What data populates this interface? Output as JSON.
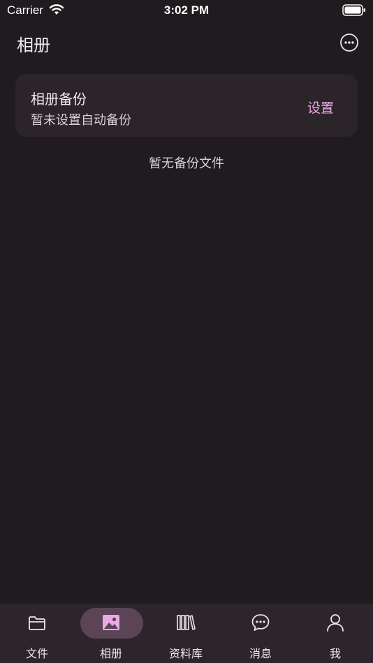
{
  "status_bar": {
    "carrier": "Carrier",
    "time": "3:02 PM"
  },
  "header": {
    "title": "相册",
    "more_icon": "more-horizontal-circle-icon"
  },
  "backup_card": {
    "title": "相册备份",
    "subtitle": "暂未设置自动备份",
    "action": "设置"
  },
  "empty_state": {
    "text": "暂无备份文件"
  },
  "tab_bar": {
    "active": "相册",
    "tabs": [
      {
        "label": "文件",
        "icon": "folder-icon"
      },
      {
        "label": "相册",
        "icon": "image-icon"
      },
      {
        "label": "资料库",
        "icon": "library-icon"
      },
      {
        "label": "消息",
        "icon": "chat-bubble-icon"
      },
      {
        "label": "我",
        "icon": "person-icon"
      }
    ]
  },
  "colors": {
    "background": "#201b1f",
    "card": "#2b2429",
    "accent": "#eba9e6",
    "tab_bar": "#2d252b",
    "active_pill": "#5a4456"
  }
}
